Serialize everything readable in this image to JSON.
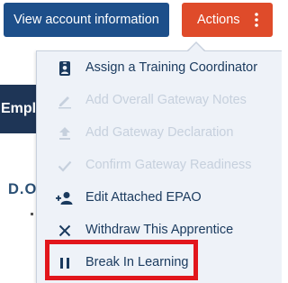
{
  "header": {
    "view_account_label": "View account information",
    "actions_label": "Actions"
  },
  "background": {
    "section_heading": "Employer",
    "dob_label": "D.O.B"
  },
  "actions_menu": {
    "items": [
      {
        "label": "Assign a Training Coordinator",
        "icon": "id-badge-icon",
        "enabled": true
      },
      {
        "label": "Add Overall Gateway Notes",
        "icon": "pencil-icon",
        "enabled": false
      },
      {
        "label": "Add Gateway Declaration",
        "icon": "upload-icon",
        "enabled": false
      },
      {
        "label": "Confirm Gateway Readiness",
        "icon": "checkmark-icon",
        "enabled": false
      },
      {
        "label": "Edit Attached EPAO",
        "icon": "add-user-icon",
        "enabled": true
      },
      {
        "label": "Withdraw This Apprentice",
        "icon": "close-icon",
        "enabled": true
      },
      {
        "label": "Break In Learning",
        "icon": "pause-icon",
        "enabled": true
      }
    ]
  },
  "colors": {
    "primary_blue": "#1d4f8a",
    "actions_orange": "#df4b2a",
    "menu_background": "#eef2f8",
    "menu_text": "#1a3a5e",
    "menu_text_disabled": "#c6d0dd",
    "highlight_red": "#e2161c"
  }
}
